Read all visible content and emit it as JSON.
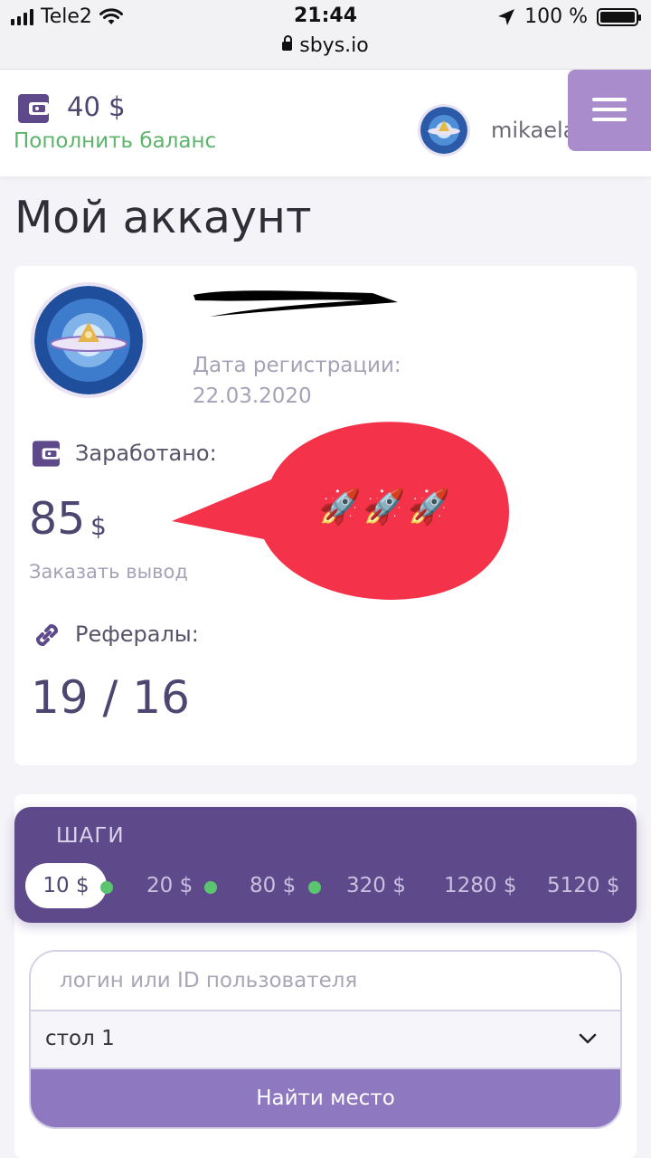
{
  "status_bar": {
    "carrier": "Tele2",
    "time": "21:44",
    "battery": "100 %",
    "url": "sbys.io",
    "icons": [
      "signal-icon",
      "wifi-icon",
      "location-arrow-icon",
      "battery-icon",
      "lock-icon"
    ]
  },
  "header": {
    "balance": "40 $",
    "topup_label": "Пополнить баланс",
    "username": "mikaela",
    "icons": [
      "wallet-icon",
      "avatar",
      "menu-icon"
    ]
  },
  "page": {
    "title": "Мой аккаунт"
  },
  "account": {
    "reg_label": "Дата регистрации:",
    "reg_date": "22.03.2020",
    "earned_label": "Заработано:",
    "earned_value": "85",
    "earned_unit": "$",
    "withdraw_label": "Заказать вывод",
    "referrals_label": "Рефералы:",
    "referrals_value": "19 / 16"
  },
  "overlay": {
    "emoji": "🚀🚀🚀",
    "bubble_color": "#f4324a"
  },
  "steps": {
    "title": "ШАГИ",
    "items": [
      {
        "label": "10 $",
        "active": true,
        "done": true
      },
      {
        "label": "20 $",
        "active": false,
        "done": true
      },
      {
        "label": "80 $",
        "active": false,
        "done": true
      },
      {
        "label": "320 $",
        "active": false,
        "done": false
      },
      {
        "label": "1280 $",
        "active": false,
        "done": false
      },
      {
        "label": "5120 $",
        "active": false,
        "done": false
      }
    ]
  },
  "search": {
    "placeholder": "логин или ID пользователя",
    "table_value": "стол 1",
    "button_label": "Найти место"
  },
  "colors": {
    "accent": "#5e4a8b",
    "menu_button": "#a98ccb",
    "topup_green": "#5bb46a",
    "progress_dot": "#5bc46e",
    "find_button": "#8e78bf"
  }
}
